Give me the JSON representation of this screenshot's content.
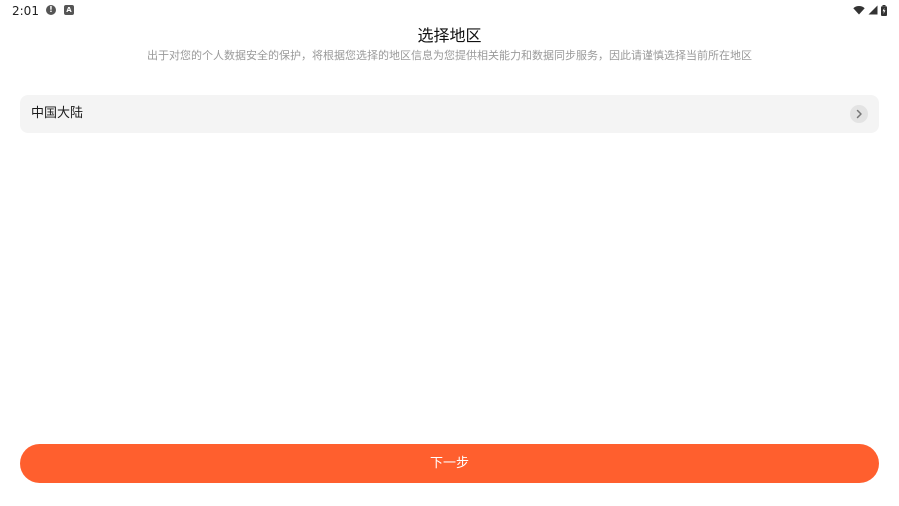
{
  "status_bar": {
    "time": "2:01",
    "alert_glyph": "!",
    "a_glyph": "A",
    "icons": [
      "alert-icon",
      "a-icon",
      "wifi-icon",
      "signal-icon",
      "battery-icon"
    ]
  },
  "header": {
    "title": "选择地区",
    "subtitle": "出于对您的个人数据安全的保护，将根据您选择的地区信息为您提供相关能力和数据同步服务，因此请谨慎选择当前所在地区"
  },
  "region": {
    "selected": "中国大陆",
    "icon": "chevron-right-icon"
  },
  "actions": {
    "next_label": "下一步"
  },
  "colors": {
    "accent": "#ff5f2e",
    "row_bg": "#f4f4f4",
    "subtitle": "#9a9a9a"
  }
}
